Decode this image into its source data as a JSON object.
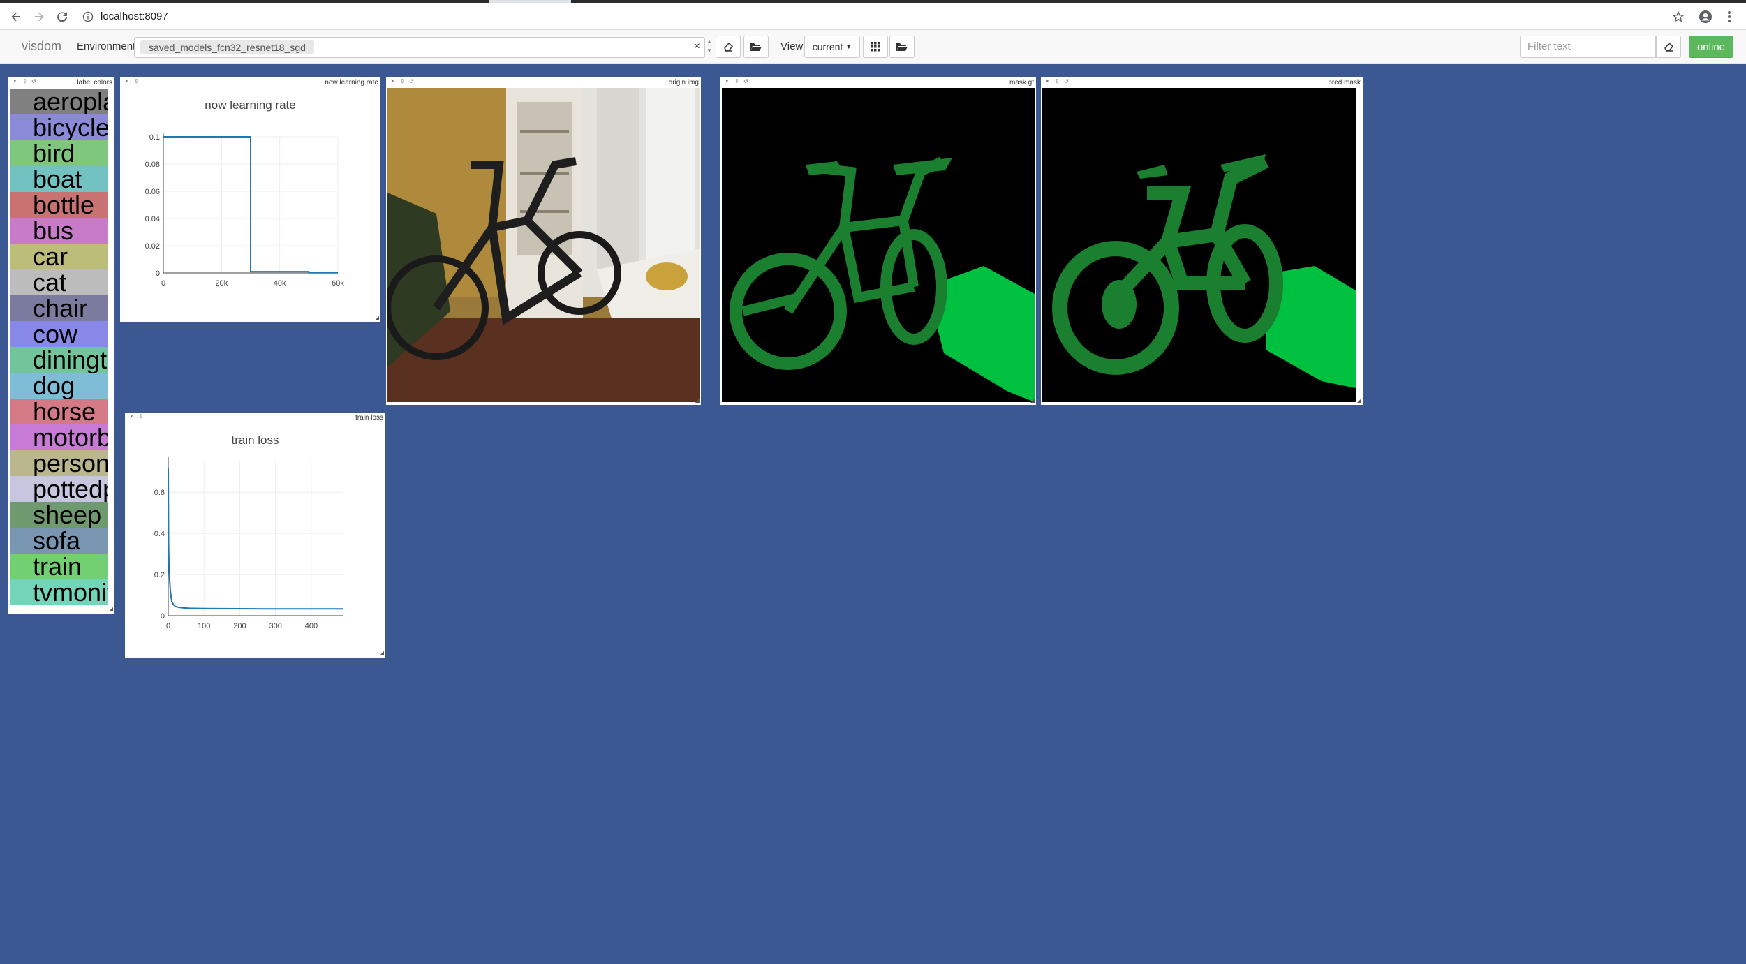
{
  "browser": {
    "url": "localhost:8097"
  },
  "navbar": {
    "brand": "visdom",
    "environment_label": "Environment",
    "environment_value": "saved_models_fcn32_resnet18_sgd",
    "clear_symbol": "×",
    "view_label": "View",
    "view_select": "current",
    "filter_placeholder": "Filter text",
    "online_label": "online"
  },
  "panes": {
    "label_colors": {
      "title": "label colors",
      "labels": [
        {
          "text": "aeroplane",
          "color": "#808080"
        },
        {
          "text": "bicycle",
          "color": "#8a8ad8"
        },
        {
          "text": "bird",
          "color": "#7fc77f"
        },
        {
          "text": "boat",
          "color": "#72c2c2"
        },
        {
          "text": "bottle",
          "color": "#c97272"
        },
        {
          "text": "bus",
          "color": "#c87bc8"
        },
        {
          "text": "car",
          "color": "#bdbd7a"
        },
        {
          "text": "cat",
          "color": "#bcbcbc"
        },
        {
          "text": "chair",
          "color": "#7b7b9f"
        },
        {
          "text": "cow",
          "color": "#8888e8"
        },
        {
          "text": "diningtable",
          "color": "#72c49a"
        },
        {
          "text": "dog",
          "color": "#7fbcd6"
        },
        {
          "text": "horse",
          "color": "#d47a86"
        },
        {
          "text": "motorbike",
          "color": "#c87bd6"
        },
        {
          "text": "person",
          "color": "#bab78f"
        },
        {
          "text": "pottedplant",
          "color": "#c6c6de"
        },
        {
          "text": "sheep",
          "color": "#6f9a6f"
        },
        {
          "text": "sofa",
          "color": "#7895b2"
        },
        {
          "text": "train",
          "color": "#72cf72"
        },
        {
          "text": "tvmonitor",
          "color": "#72d4b8"
        }
      ]
    },
    "lr": {
      "title": "now learning rate"
    },
    "loss": {
      "title": "train loss"
    },
    "origin": {
      "title": "origin img"
    },
    "mask_gt": {
      "title": "mask gt"
    },
    "pred": {
      "title": "pred mask"
    }
  },
  "chart_data": [
    {
      "type": "line",
      "title": "now learning rate",
      "xlabel": "",
      "ylabel": "",
      "xlim": [
        0,
        60000
      ],
      "ylim": [
        0,
        0.1
      ],
      "x_ticks": [
        "0",
        "20k",
        "40k",
        "60k"
      ],
      "y_ticks": [
        "0",
        "0.02",
        "0.04",
        "0.06",
        "0.08",
        "0.1"
      ],
      "series": [
        {
          "x": [
            0,
            30000,
            30000,
            50000,
            50000,
            60000
          ],
          "y": [
            0.1,
            0.1,
            0.001,
            0.001,
            0.0001,
            0.0001
          ]
        }
      ],
      "grid": true
    },
    {
      "type": "line",
      "title": "train loss",
      "xlabel": "",
      "ylabel": "",
      "xlim": [
        0,
        490
      ],
      "ylim": [
        0,
        0.75
      ],
      "x_ticks": [
        "0",
        "100",
        "200",
        "300",
        "400"
      ],
      "y_ticks": [
        "0",
        "0.2",
        "0.4",
        "0.6"
      ],
      "series": [
        {
          "x": [
            0,
            1,
            2,
            4,
            6,
            8,
            10,
            14,
            20,
            30,
            40,
            60,
            100,
            200,
            300,
            400,
            490
          ],
          "y": [
            0.72,
            0.35,
            0.26,
            0.17,
            0.12,
            0.09,
            0.07,
            0.055,
            0.045,
            0.04,
            0.038,
            0.036,
            0.035,
            0.034,
            0.033,
            0.033,
            0.033
          ]
        }
      ],
      "grid": true
    }
  ]
}
